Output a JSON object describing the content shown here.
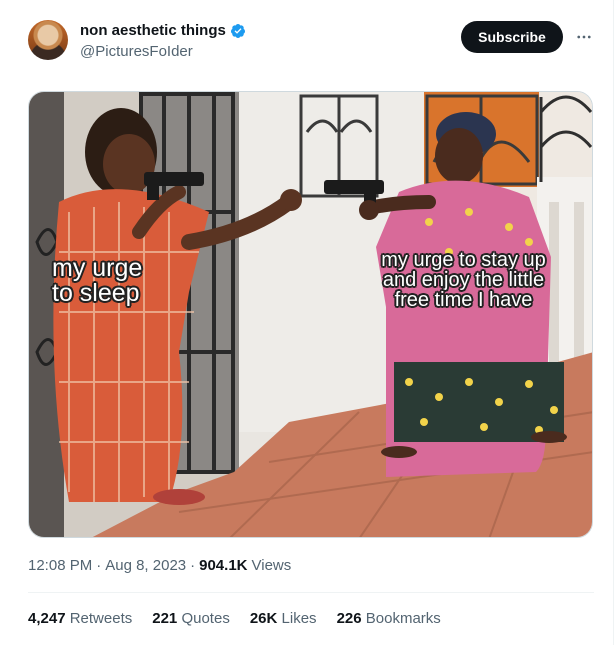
{
  "author": {
    "name": "non aesthetic things",
    "handle": "@PicturesFoIder",
    "verified": true,
    "avatar_icon": "profile-avatar"
  },
  "subscribe_label": "Subscribe",
  "more_icon": "ellipsis-icon",
  "meme": {
    "left_caption_line1": "my urge",
    "left_caption_line2": "to sleep",
    "right_caption_line1": "my urge to stay up",
    "right_caption_line2": "and enjoy the little",
    "right_caption_line3": "free time I have"
  },
  "meta": {
    "time": "12:08 PM",
    "sep1": "·",
    "date": "Aug 8, 2023",
    "sep2": "·",
    "views_count": "904.1K",
    "views_label": "Views"
  },
  "stats": [
    {
      "num": "4,247",
      "label": "Retweets"
    },
    {
      "num": "221",
      "label": "Quotes"
    },
    {
      "num": "26K",
      "label": "Likes"
    },
    {
      "num": "226",
      "label": "Bookmarks"
    }
  ],
  "colors": {
    "accent_verified": "#1d9bf0",
    "text_primary": "#0f1419",
    "text_secondary": "#536471"
  }
}
